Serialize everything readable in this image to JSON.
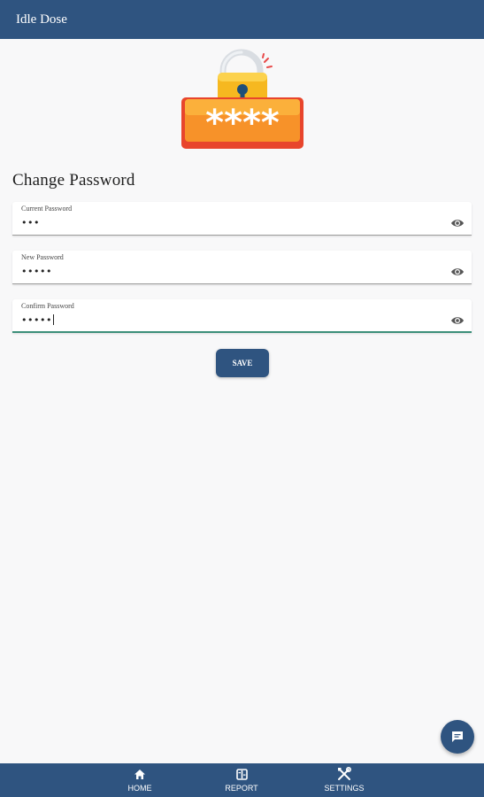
{
  "app_bar": {
    "title": "Idle Dose"
  },
  "page": {
    "title": "Change Password"
  },
  "form": {
    "current_password": {
      "label": "Current Password",
      "value": "•••"
    },
    "new_password": {
      "label": "New Password",
      "value": "•••••"
    },
    "confirm_password": {
      "label": "Confirm Password",
      "value": "•••••"
    }
  },
  "illustration": {
    "masked_text": "****"
  },
  "actions": {
    "save_label": "SAVE"
  },
  "bottom_nav": {
    "items": [
      {
        "label": "HOME",
        "icon": "home-icon"
      },
      {
        "label": "REPORT",
        "icon": "report-icon"
      },
      {
        "label": "SETTINGS",
        "icon": "settings-tools-icon"
      }
    ]
  },
  "fab": {
    "icon": "chat-icon"
  },
  "colors": {
    "primary": "#2f5480",
    "background": "#f8f8f9",
    "focus_underline": "#3c8f7a"
  }
}
